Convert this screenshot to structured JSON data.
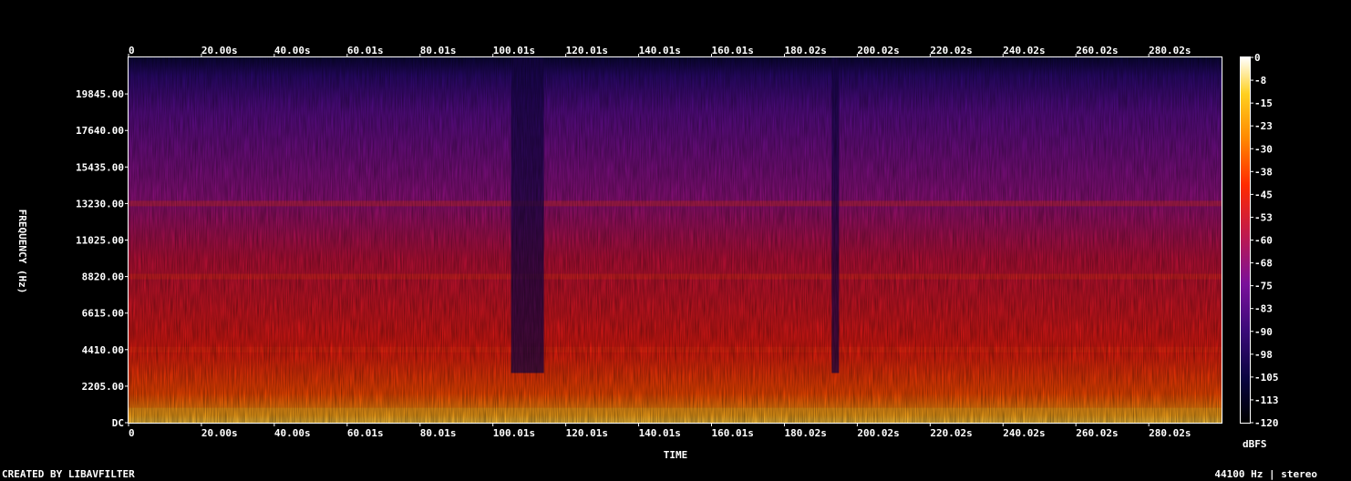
{
  "chart_data": {
    "type": "heatmap",
    "title": "",
    "xlabel": "TIME",
    "ylabel": "FREQUENCY (Hz)",
    "x_ticks": [
      "0",
      "20.00s",
      "40.00s",
      "60.01s",
      "80.01s",
      "100.01s",
      "120.01s",
      "140.01s",
      "160.01s",
      "180.02s",
      "200.02s",
      "220.02s",
      "240.02s",
      "260.02s",
      "280.02s"
    ],
    "x_tick_values": [
      0,
      20.0,
      40.0,
      60.01,
      80.01,
      100.01,
      120.01,
      140.01,
      160.01,
      180.02,
      200.02,
      220.02,
      240.02,
      260.02,
      280.02
    ],
    "xlim": [
      0,
      300
    ],
    "y_ticks": [
      "DC",
      "2205.00",
      "4410.00",
      "6615.00",
      "8820.00",
      "11025.00",
      "13230.00",
      "15435.00",
      "17640.00",
      "19845.00"
    ],
    "y_tick_values": [
      0,
      2205,
      4410,
      6615,
      8820,
      11025,
      13230,
      15435,
      17640,
      19845
    ],
    "ylim": [
      0,
      22050
    ],
    "colorbar": {
      "label": "dBFS",
      "ticks": [
        "0",
        "-8",
        "-15",
        "-23",
        "-30",
        "-38",
        "-45",
        "-53",
        "-60",
        "-68",
        "-75",
        "-83",
        "-90",
        "-98",
        "-105",
        "-113",
        "-120"
      ],
      "range": [
        -120,
        0
      ],
      "colors": [
        "#000000",
        "#0a0540",
        "#3a0a78",
        "#7a109a",
        "#c21a4a",
        "#ff2a00",
        "#ff8a00",
        "#ffd020",
        "#ffffff"
      ]
    },
    "quiet_segments_s": [
      [
        105,
        114
      ],
      [
        193,
        195
      ]
    ],
    "bright_bands_hz": [
      13230,
      8820,
      4410
    ]
  },
  "footer": {
    "left": "CREATED BY LIBAVFILTER",
    "right": "44100 Hz | stereo"
  }
}
